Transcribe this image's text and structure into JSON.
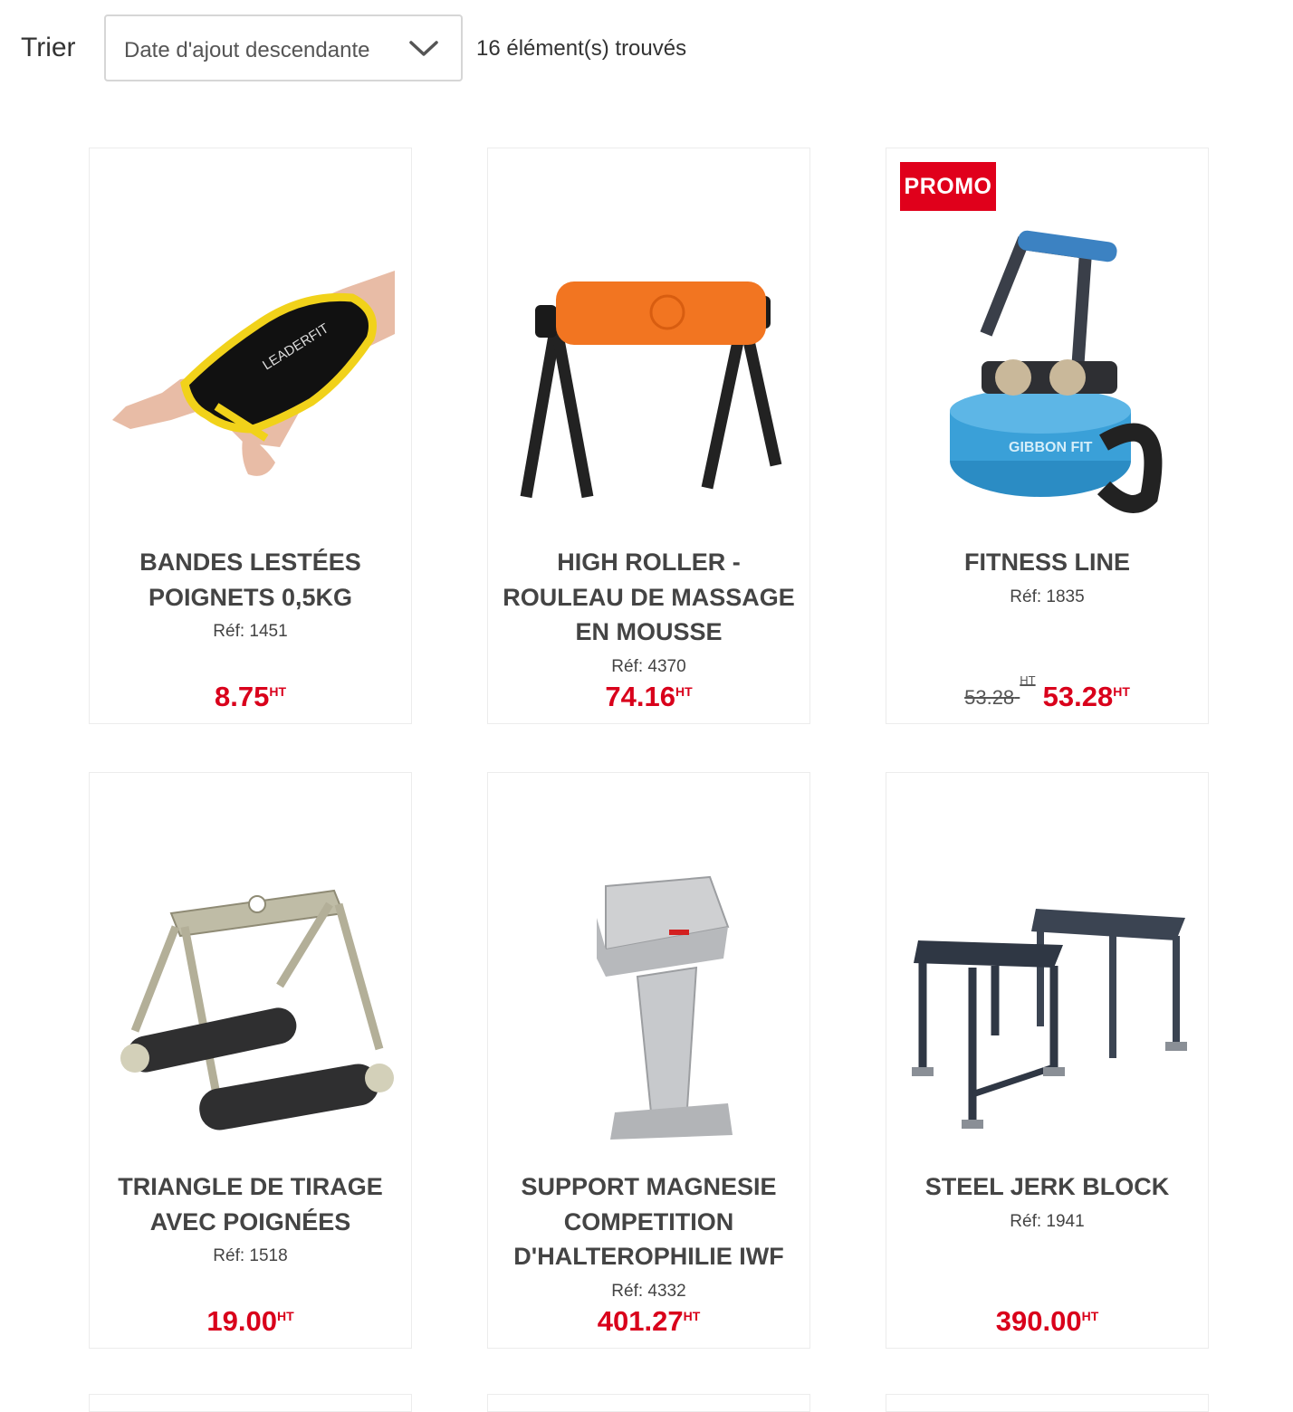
{
  "toolbar": {
    "sort_label": "Trier",
    "sort_value": "Date d'ajout descendante",
    "results_count": "16 élément(s) trouvés"
  },
  "products": [
    {
      "title": "BANDES LESTÉES POIGNETS 0,5KG",
      "ref": "Réf: 1451",
      "price": "8.75",
      "unit": "HT"
    },
    {
      "title": "HIGH ROLLER - ROULEAU DE MASSAGE EN MOUSSE",
      "ref": "Réf: 4370",
      "price": "74.16",
      "unit": "HT"
    },
    {
      "title": "FITNESS LINE",
      "ref": "Réf: 1835",
      "old_price": "53.28",
      "old_unit": "HT",
      "price": "53.28",
      "unit": "HT",
      "badge": "PROMO"
    },
    {
      "title": "TRIANGLE DE TIRAGE AVEC POIGNÉES",
      "ref": "Réf: 1518",
      "price": "19.00",
      "unit": "HT"
    },
    {
      "title": "SUPPORT MAGNESIE COMPETITION D'HALTEROPHILIE IWF",
      "ref": "Réf: 4332",
      "price": "401.27",
      "unit": "HT"
    },
    {
      "title": "STEEL JERK BLOCK",
      "ref": "Réf: 1941",
      "price": "390.00",
      "unit": "HT"
    }
  ]
}
